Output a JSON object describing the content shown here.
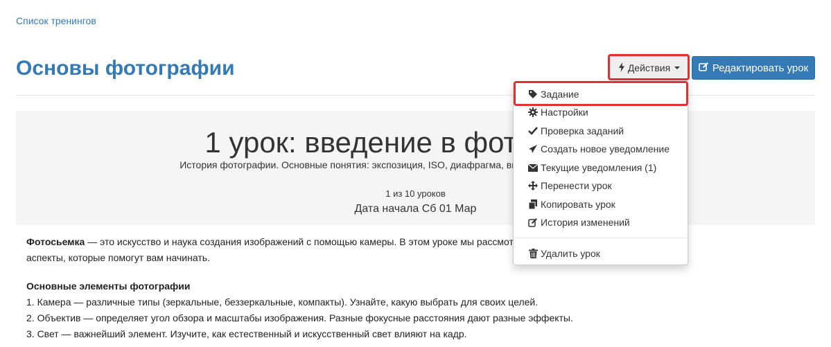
{
  "breadcrumb": {
    "label": "Список тренингов"
  },
  "page": {
    "title": "Основы фотографии"
  },
  "toolbar": {
    "actions_label": "Действия",
    "edit_label": "Редактировать урок"
  },
  "lesson": {
    "title": "1 урок: введение в фотосьемку",
    "description": "История фотографии. Основные понятия: экспозиция, ISO, диафрагма, выдержка. Обзор типов камер и",
    "count": "1 из 10 уроков",
    "start_date": "Дата начала Сб 01 Мар"
  },
  "content": {
    "intro_bold": "Фотосьемка",
    "intro_rest": " — это искусство и наука создания изображений с помощью камеры. В этом уроке мы рассмотрим",
    "intro_line2": "аспекты, которые помогут вам начинать.",
    "section_title": "Основные элементы фотографии",
    "items": [
      "1. Камера — различные типы (зеркальные, беззеркальные, компакты). Узнайте, какую выбрать для своих целей.",
      "2. Объектив — определяет угол обзора и масштабы изображения. Разные фокусные расстояния дают разные эффекты.",
      "3. Свет — важнейший элемент. Изучите, как естественный и искусственный свет влияют на кадр."
    ]
  },
  "menu": {
    "items": [
      {
        "label": "Задание",
        "icon": "tag-icon"
      },
      {
        "label": "Настройки",
        "icon": "gear-icon"
      },
      {
        "label": "Проверка заданий",
        "icon": "check-icon"
      },
      {
        "label": "Создать новое уведомление",
        "icon": "send-icon"
      },
      {
        "label": "Текущие уведомления (1)",
        "icon": "envelope-icon"
      },
      {
        "label": "Перенести урок",
        "icon": "move-icon"
      },
      {
        "label": "Копировать урок",
        "icon": "copy-icon"
      },
      {
        "label": "История изменений",
        "icon": "edit-icon"
      },
      {
        "label": "Удалить урок",
        "icon": "trash-icon"
      }
    ]
  },
  "colors": {
    "link": "#337ab7",
    "primary_button": "#337ab7",
    "highlight": "#e03131",
    "header_bg": "#f5f5f5"
  }
}
